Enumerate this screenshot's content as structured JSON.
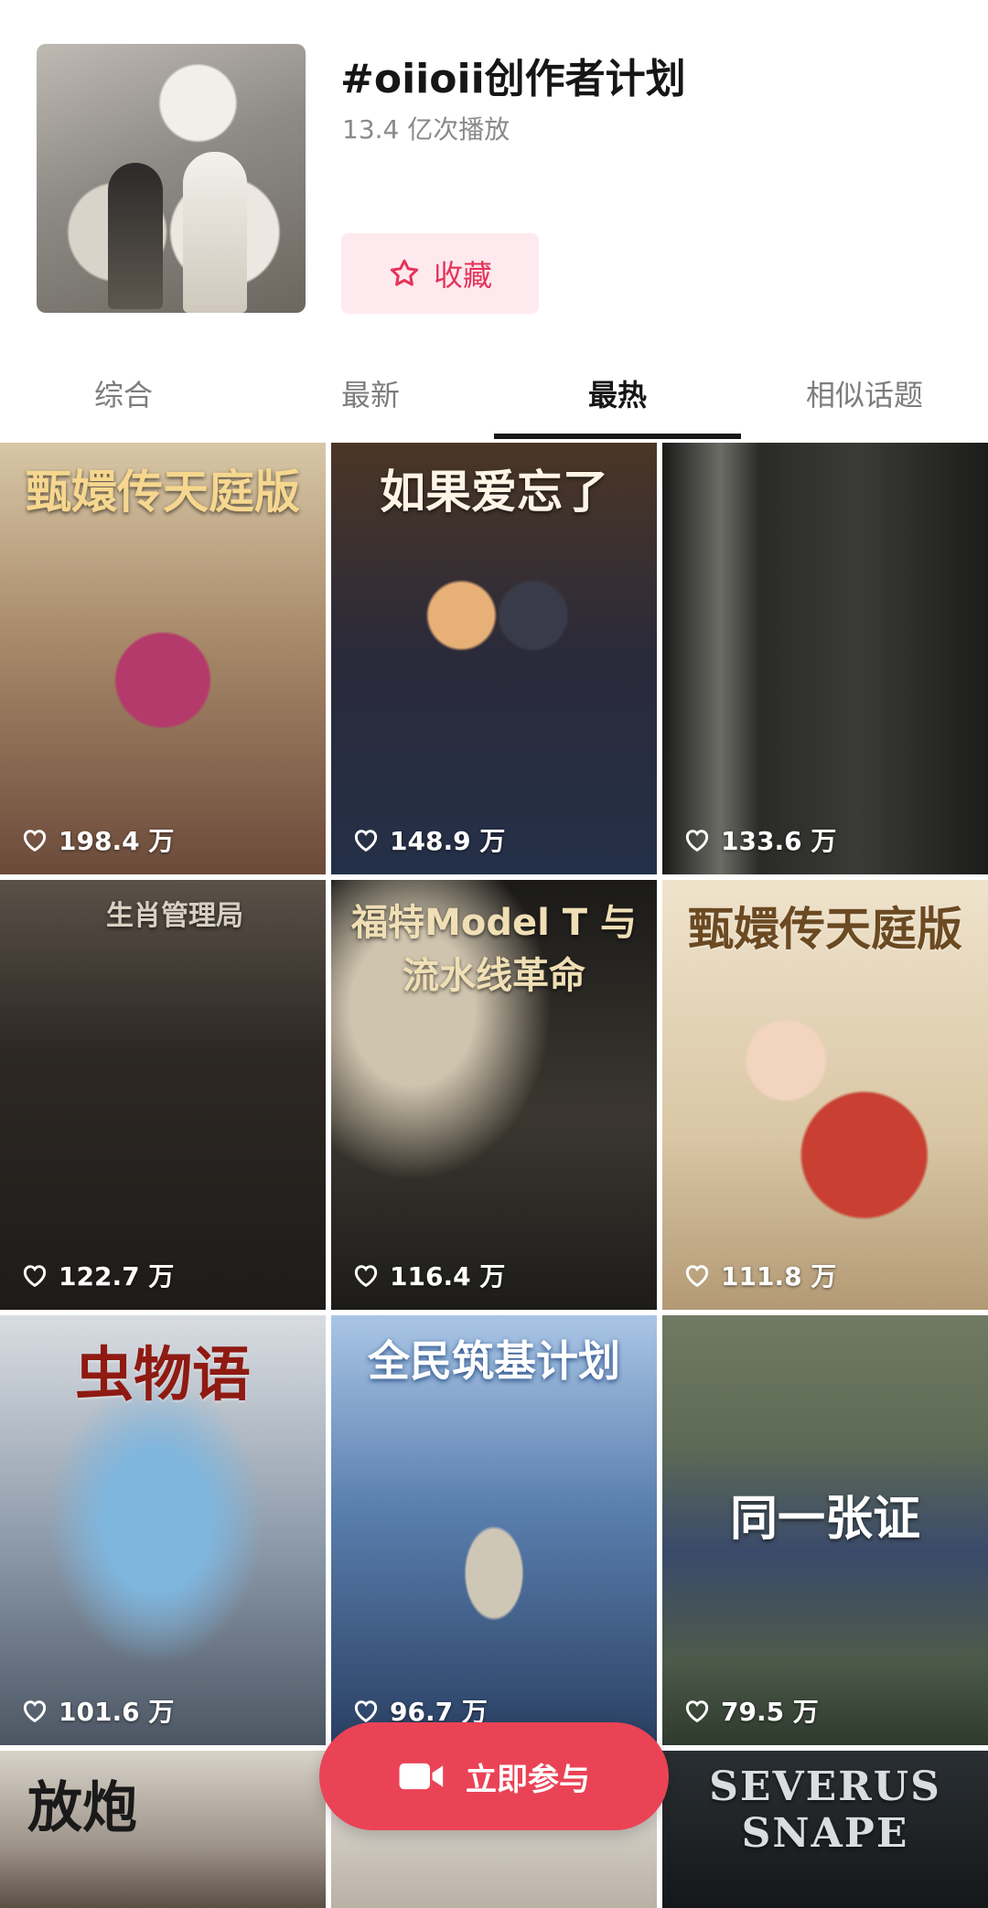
{
  "topic": {
    "title": "#oiioii创作者计划",
    "plays": "13.4 亿次播放",
    "favorite_label": "收藏"
  },
  "tabs": [
    {
      "label": "综合",
      "active": false
    },
    {
      "label": "最新",
      "active": false
    },
    {
      "label": "最热",
      "active": true
    },
    {
      "label": "相似话题",
      "active": false
    }
  ],
  "videos": [
    {
      "overlay": "甄嬛传天庭版",
      "likes": "198.4 万"
    },
    {
      "overlay": "如果爱忘了",
      "likes": "148.9 万"
    },
    {
      "overlay": "",
      "likes": "133.6 万"
    },
    {
      "overlay": "生肖管理局",
      "likes": "122.7 万"
    },
    {
      "overlay": "福特Model T 与流水线革命",
      "likes": "116.4 万"
    },
    {
      "overlay": "甄嬛传天庭版",
      "likes": "111.8 万"
    },
    {
      "overlay": "虫物语",
      "likes": "101.6 万"
    },
    {
      "overlay": "全民筑基计划",
      "likes": "96.7 万"
    },
    {
      "overlay": "同一张证",
      "likes": "79.5 万"
    },
    {
      "overlay": "放炮",
      "likes": ""
    },
    {
      "overlay": "",
      "likes": ""
    },
    {
      "overlay": "SEVERUS SNAPE",
      "likes": ""
    }
  ],
  "join_label": "立即参与",
  "colors": {
    "accent": "#ea4356",
    "favorite_bg": "#fde9ee",
    "favorite_text": "#e5345a"
  }
}
